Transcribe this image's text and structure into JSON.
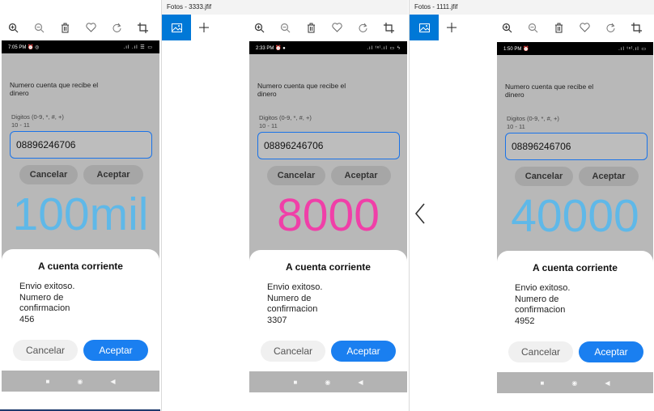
{
  "windows": [
    {
      "title": "",
      "statusbar": {
        "time": "7:05 PM ⏰ ◎",
        "icons": ".ıl .ıl ☰ ▭"
      },
      "amount": "100mil",
      "amount_color": "#5fb8e8",
      "confirmation": "456"
    },
    {
      "title": "Fotos - 3333.jfif",
      "statusbar": {
        "time": "2:33 PM ⏰   ●",
        "icons": ".ıl ᵗᵉˡ.ıl ▭ ϟ"
      },
      "amount": "8000",
      "amount_color": "#f03fa8",
      "confirmation": "3307"
    },
    {
      "title": "Fotos - 1111.jfif",
      "statusbar": {
        "time": "1:50 PM ⏰",
        "icons": ".ıl ᵗᵉˡ.ıl ▭"
      },
      "amount": "40000",
      "amount_color": "#5fb8e8",
      "confirmation": "4952"
    }
  ],
  "form": {
    "recv_label": "Numero cuenta que recibe el dinero",
    "digits_label_1": "Digitos (0-9, *, #, +)",
    "digits_label_2": "10 - 11",
    "account_value": "08896246706",
    "cancel_label": "Cancelar",
    "accept_label": "Aceptar"
  },
  "dialog": {
    "title": "A cuenta corriente",
    "line1": "Envio exitoso.",
    "line2": "Numero de",
    "line3": "confirmacion",
    "cancel_label": "Cancelar",
    "accept_label": "Aceptar"
  },
  "navbar": {
    "recent": "■",
    "home": "◉",
    "back": "◀"
  },
  "colors": {
    "accent": "#0078d7",
    "dialog_accept": "#1a7ff0",
    "phone_bg": "#b8b8b8"
  },
  "icons": [
    "zoom-in-icon",
    "zoom-out-icon",
    "delete-icon",
    "favorite-icon",
    "rotate-icon",
    "crop-icon",
    "image-tab-icon",
    "new-tab-icon",
    "previous-chevron-icon"
  ]
}
